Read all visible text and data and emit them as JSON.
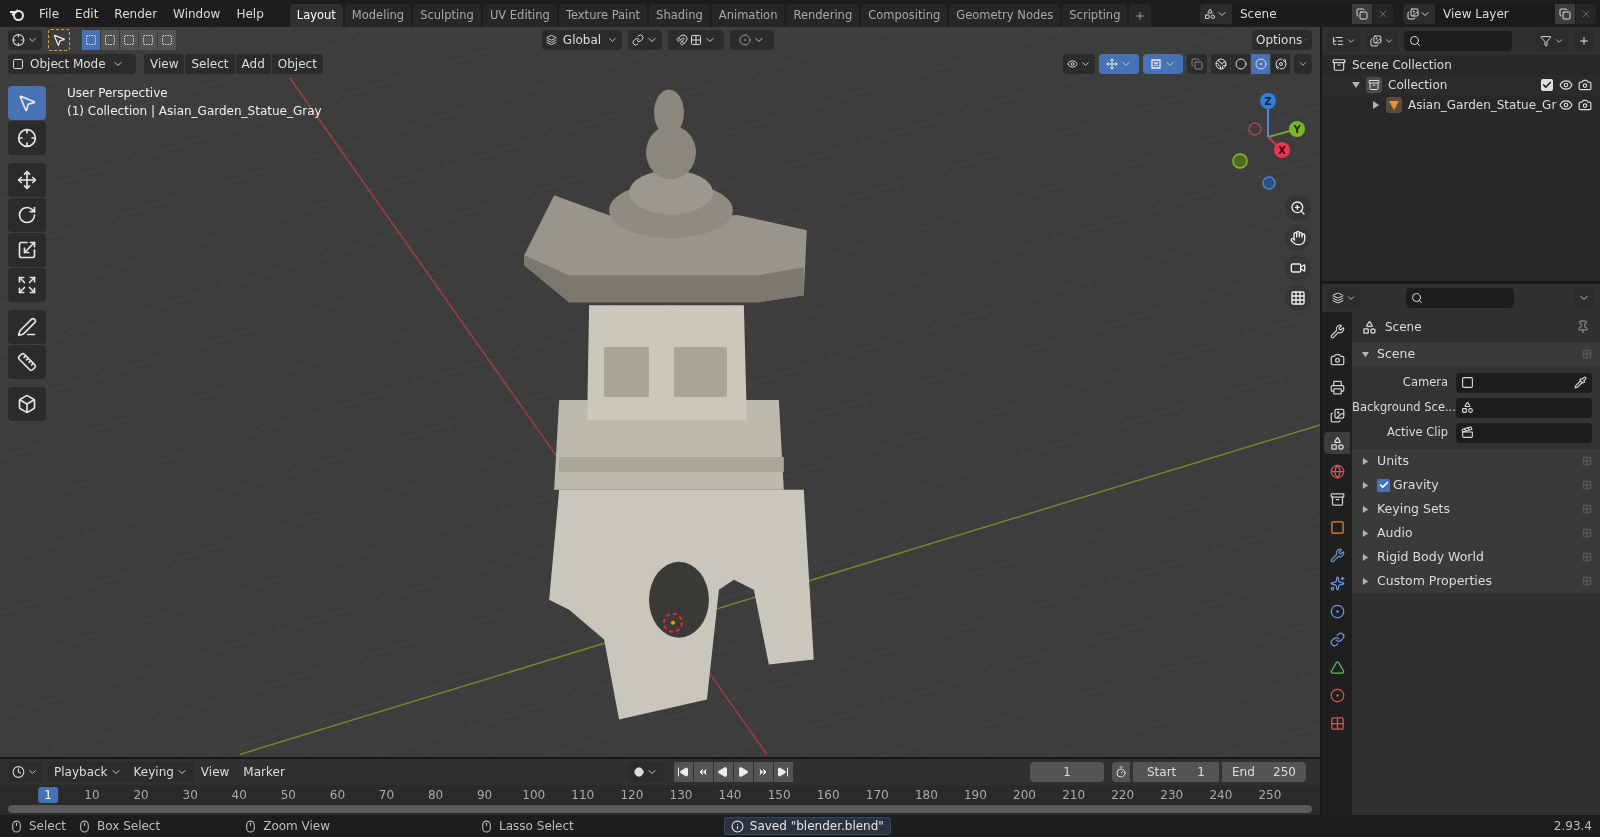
{
  "menu_bar": {
    "menus": [
      "File",
      "Edit",
      "Render",
      "Window",
      "Help"
    ],
    "workspace_tabs": [
      {
        "label": "Layout",
        "selected": true
      },
      {
        "label": "Modeling",
        "selected": false
      },
      {
        "label": "Sculpting",
        "selected": false
      },
      {
        "label": "UV Editing",
        "selected": false
      },
      {
        "label": "Texture Paint",
        "selected": false
      },
      {
        "label": "Shading",
        "selected": false
      },
      {
        "label": "Animation",
        "selected": false
      },
      {
        "label": "Rendering",
        "selected": false
      },
      {
        "label": "Compositing",
        "selected": false
      },
      {
        "label": "Geometry Nodes",
        "selected": false
      },
      {
        "label": "Scripting",
        "selected": false
      }
    ],
    "scene": "Scene",
    "view_layer": "View Layer"
  },
  "viewport": {
    "header": {
      "snap_on": false,
      "proportional_on": false,
      "gizmo_on": true,
      "overlay_on": true,
      "orientation": "Global",
      "options": "Options",
      "mode": "Object Mode",
      "menus": [
        "View",
        "Select",
        "Add",
        "Object"
      ],
      "select_modes": [
        {
          "selected": true
        },
        {
          "selected": false
        },
        {
          "selected": false
        },
        {
          "selected": false
        },
        {
          "selected": false
        }
      ],
      "shading_modes": [
        {
          "kind": "wireframe",
          "selected": false
        },
        {
          "kind": "solid",
          "selected": false
        },
        {
          "kind": "material",
          "selected": true
        },
        {
          "kind": "rendered",
          "selected": false
        }
      ]
    },
    "overlay": [
      "User Perspective",
      "(1) Collection | Asian_Garden_Statue_Gray"
    ],
    "tools": [
      {
        "kind": "select",
        "selected": true
      },
      {
        "kind": "cursor",
        "selected": false
      },
      {
        "kind": "move",
        "selected": false
      },
      {
        "kind": "rotate",
        "selected": false
      },
      {
        "kind": "scale",
        "selected": false
      },
      {
        "kind": "transform",
        "selected": false
      },
      {
        "kind": "annotate",
        "selected": false
      },
      {
        "kind": "measure",
        "selected": false
      },
      {
        "kind": "add-cube",
        "selected": false
      }
    ],
    "gizmo": {
      "z": "Z",
      "y": "Y",
      "x": "X"
    }
  },
  "outliner": {
    "tree": [
      {
        "label": "Scene Collection",
        "kind": "scene-collection",
        "children": [
          {
            "label": "Collection",
            "kind": "collection",
            "expanded": true,
            "checked": true,
            "children": [
              {
                "label": "Asian_Garden_Statue_Gr",
                "kind": "object",
                "expanded": false
              }
            ]
          }
        ]
      }
    ]
  },
  "properties": {
    "tabs": [
      {
        "kind": "tool",
        "selected": false
      },
      {
        "kind": "render",
        "selected": false
      },
      {
        "kind": "output",
        "selected": false
      },
      {
        "kind": "view-layer",
        "selected": false
      },
      {
        "kind": "scene",
        "selected": true
      },
      {
        "kind": "world",
        "selected": false
      },
      {
        "kind": "collection",
        "selected": false
      },
      {
        "kind": "object",
        "selected": false
      },
      {
        "kind": "modifiers",
        "selected": false
      },
      {
        "kind": "particles",
        "selected": false
      },
      {
        "kind": "physics",
        "selected": false
      },
      {
        "kind": "constraints",
        "selected": false
      },
      {
        "kind": "data",
        "selected": false
      },
      {
        "kind": "material",
        "selected": false
      },
      {
        "kind": "texture",
        "selected": false
      }
    ],
    "context": "Scene",
    "panels": [
      {
        "label": "Scene",
        "expanded": true,
        "fields": [
          {
            "label": "Camera",
            "kind": "camera"
          },
          {
            "label": "Background Sce...",
            "kind": "scene"
          },
          {
            "label": "Active Clip",
            "kind": "clip"
          }
        ]
      },
      {
        "label": "Units",
        "expanded": false
      },
      {
        "label": "Gravity",
        "expanded": false,
        "checked": true
      },
      {
        "label": "Keying Sets",
        "expanded": false
      },
      {
        "label": "Audio",
        "expanded": false
      },
      {
        "label": "Rigid Body World",
        "expanded": false
      },
      {
        "label": "Custom Properties",
        "expanded": false
      }
    ]
  },
  "timeline": {
    "menus": [
      {
        "label": "Playback",
        "kind": "dropdown"
      },
      {
        "label": "Keying",
        "kind": "dropdown"
      },
      {
        "label": "View",
        "kind": "menu"
      },
      {
        "label": "Marker",
        "kind": "menu"
      }
    ],
    "auto_keying_on": false,
    "current_frame": "1",
    "start": {
      "label": "Start",
      "value": "1"
    },
    "end": {
      "label": "End",
      "value": "250"
    },
    "ruler": [
      {
        "label": "1",
        "selected": true
      },
      {
        "label": "10",
        "selected": false
      },
      {
        "label": "20",
        "selected": false
      },
      {
        "label": "30",
        "selected": false
      },
      {
        "label": "40",
        "selected": false
      },
      {
        "label": "50",
        "selected": false
      },
      {
        "label": "60",
        "selected": false
      },
      {
        "label": "70",
        "selected": false
      },
      {
        "label": "80",
        "selected": false
      },
      {
        "label": "90",
        "selected": false
      },
      {
        "label": "100",
        "selected": false
      },
      {
        "label": "110",
        "selected": false
      },
      {
        "label": "120",
        "selected": false
      },
      {
        "label": "130",
        "selected": false
      },
      {
        "label": "140",
        "selected": false
      },
      {
        "label": "150",
        "selected": false
      },
      {
        "label": "160",
        "selected": false
      },
      {
        "label": "170",
        "selected": false
      },
      {
        "label": "180",
        "selected": false
      },
      {
        "label": "190",
        "selected": false
      },
      {
        "label": "200",
        "selected": false
      },
      {
        "label": "210",
        "selected": false
      },
      {
        "label": "220",
        "selected": false
      },
      {
        "label": "230",
        "selected": false
      },
      {
        "label": "240",
        "selected": false
      },
      {
        "label": "250",
        "selected": false
      }
    ]
  },
  "status_bar": {
    "hints": [
      "Select",
      "Box Select",
      "Zoom View",
      "Lasso Select"
    ],
    "message": "Saved \"blender.blend\"",
    "version": "2.93.4"
  }
}
